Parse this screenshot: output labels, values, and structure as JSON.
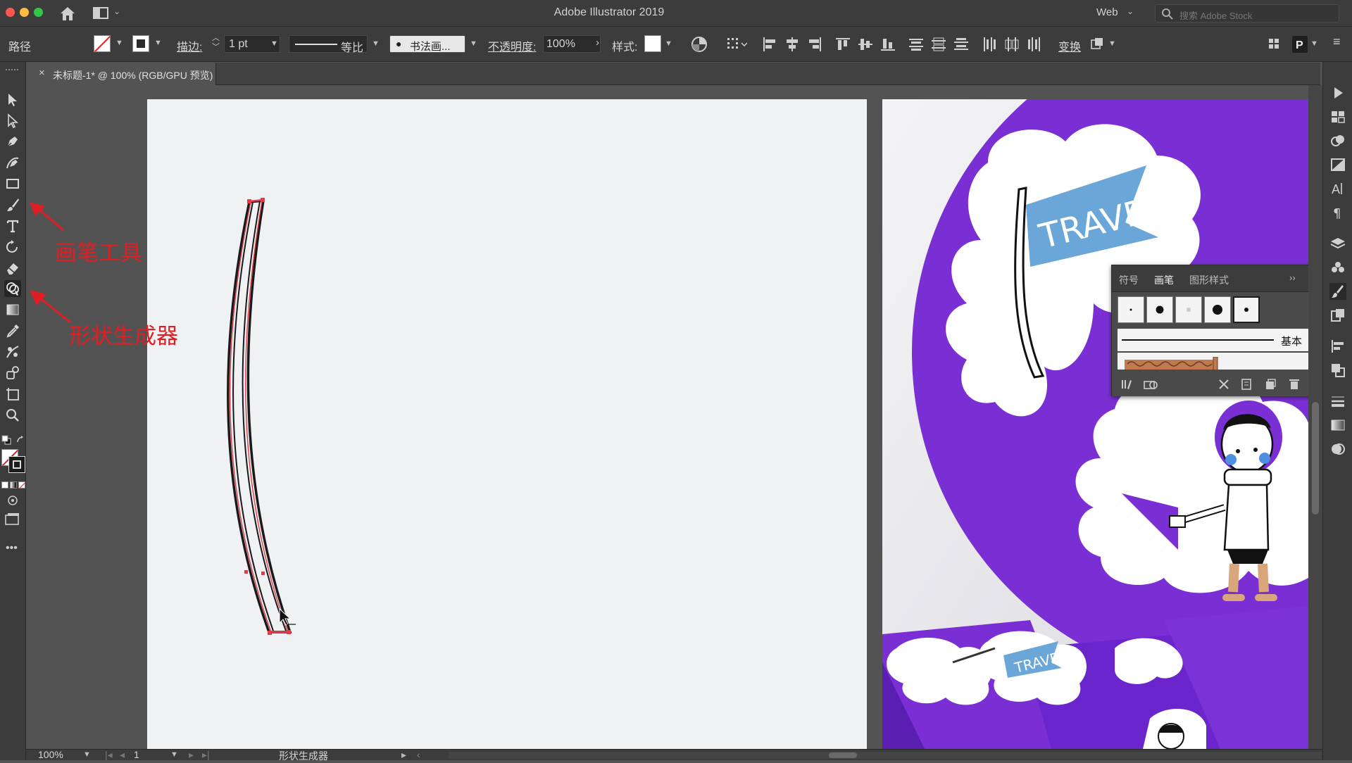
{
  "app": {
    "title": "Adobe Illustrator 2019",
    "workspace": "Web",
    "stock_search_placeholder": "搜索 Adobe Stock"
  },
  "control_bar": {
    "selection_type": "路径",
    "stroke_label": "描边:",
    "stroke_weight": "1 pt",
    "profile_label": "等比",
    "brush_label": "书法画...",
    "opacity_label": "不透明度:",
    "opacity_value": "100%",
    "style_label": "样式:",
    "transform_label": "变换"
  },
  "document_tab": {
    "close_glyph": "×",
    "title": "未标题-1* @ 100% (RGB/GPU 预览)"
  },
  "annotations": {
    "brush_tool": "画笔工具",
    "shape_builder": "形状生成器"
  },
  "brush_panel": {
    "tabs": [
      "符号",
      "画笔",
      "图形样式"
    ],
    "active_tab": "画笔",
    "basic_brush_label": "基本"
  },
  "reference_image": {
    "flag_text": "TRAVEL",
    "small_flag_text": "TRAVEL",
    "colors": {
      "purple": "#7a2fd4",
      "flag_blue": "#6aa7d8"
    }
  },
  "status_bar": {
    "zoom": "100%",
    "artboard_number": "1",
    "current_tool": "形状生成器"
  },
  "colors": {
    "ui_dark": "#3c3c3c",
    "ui_mid": "#535353",
    "artboard": "#f0f1f3",
    "annotation_red": "#e11d24",
    "path_red": "#e63946"
  }
}
